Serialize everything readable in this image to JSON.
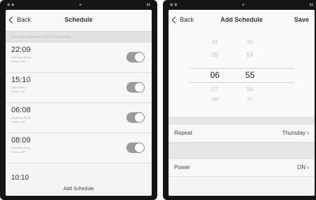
{
  "left_screen": {
    "back_label": "Back",
    "title": "Schedule",
    "subheader": "Schedule supports up to 10 schedules",
    "items": [
      {
        "time": "22:09",
        "detail1": "Weekday Every",
        "detail2": "Power: OFF"
      },
      {
        "time": "15:10",
        "detail1": "Daily Every",
        "detail2": "Power: ON"
      },
      {
        "time": "06:08",
        "detail1": "Weekday Every",
        "detail2": "Power: ON"
      },
      {
        "time": "08:09",
        "detail1": "Weekday Every",
        "detail2": "Power: OFF"
      }
    ],
    "last_time": "10:10",
    "add_label": "Add Schedule"
  },
  "right_screen": {
    "back_label": "Back",
    "title": "Add Schedule",
    "save_label": "Save",
    "picker": {
      "hours": [
        "04",
        "05",
        "06",
        "07",
        "08"
      ],
      "minutes": [
        "53",
        "54",
        "55",
        "56",
        "57"
      ],
      "selected_hour": "06",
      "selected_minute": "55"
    },
    "repeat_label": "Repeat",
    "repeat_value": "Thursday",
    "power_label": "Power",
    "power_value": "ON"
  }
}
